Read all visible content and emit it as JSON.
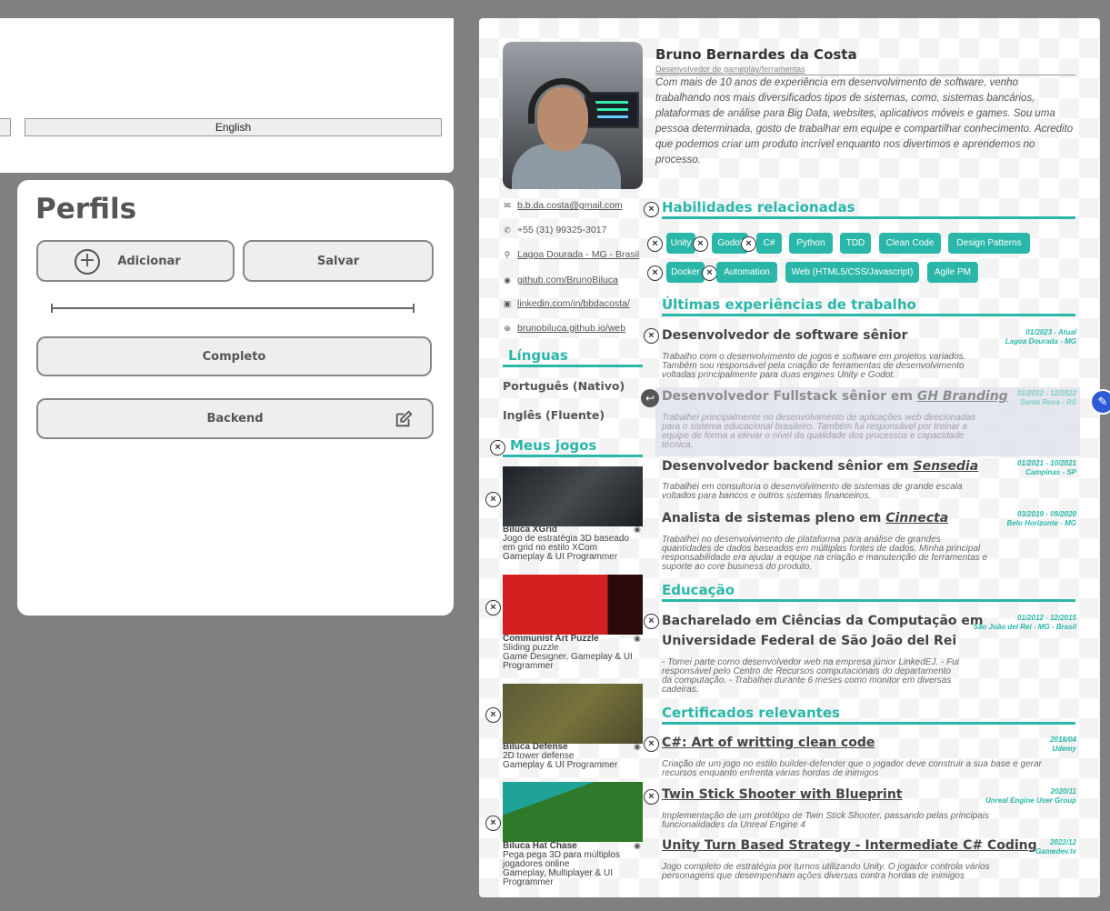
{
  "settings": {
    "language_button": "English"
  },
  "profiles": {
    "title": "Perfils",
    "add_label": "Adicionar",
    "save_label": "Salvar",
    "items": [
      "Completo",
      "Backend"
    ]
  },
  "resume": {
    "name": "Bruno Bernardes da Costa",
    "role": "Desenvolvedor de gameplay/ferramentas",
    "about": "Com mais de 10 anos de experiência em desenvolvimento de software, venho trabalhando nos mais diversificados tipos de sistemas, como, sistemas bancários, plataformas de análise para Big Data, websites, aplicativos móveis e games. Sou uma pessoa determinada, gosto de trabalhar em equipe e compartilhar conhecimento. Acredito que podemos criar um produto incrível enquanto nos divertimos e aprendemos no processo.",
    "contacts": [
      {
        "icon": "mail-icon",
        "glyph": "✉",
        "text": "b.b.da.costa@gmail.com"
      },
      {
        "icon": "phone-icon",
        "glyph": "✆",
        "text": "+55 (31) 99325-3017"
      },
      {
        "icon": "location-icon",
        "glyph": "⚲",
        "text": "Lagoa Dourada - MG - Brasil"
      },
      {
        "icon": "github-icon",
        "glyph": "◉",
        "text": "github.com/BrunoBiluca"
      },
      {
        "icon": "linkedin-icon",
        "glyph": "▣",
        "text": "linkedin.com/in/bbdacosta/"
      },
      {
        "icon": "globe-icon",
        "glyph": "⊕",
        "text": "brunobiluca.github.io/web"
      }
    ],
    "languages_title": "Línguas",
    "languages": [
      "Português (Nativo)",
      "Inglês (Fluente)"
    ],
    "games_title": "Meus jogos",
    "games": [
      {
        "title": "Biluca XGrid",
        "desc": "Jogo de estratégia 3D baseado em grid no estilo XCom",
        "roles": "Gameplay & UI Programmer"
      },
      {
        "title": "Communist Art Puzzle",
        "desc": "Sliding puzzle",
        "roles": "Game Designer, Gameplay & UI Programmer"
      },
      {
        "title": "Biluca Defense",
        "desc": "2D tower defense",
        "roles": "Gameplay & UI Programmer"
      },
      {
        "title": "Biluca Hat Chase",
        "desc": "Pega pega 3D para múltiplos jogadores online",
        "roles": "Gameplay, Multiplayer & UI Programmer"
      }
    ],
    "skills_title": "Habilidades relacionadas",
    "skills": [
      "Unity",
      "Godot",
      "C#",
      "Python",
      "TDD",
      "Clean Code",
      "Design Patterns",
      "Docker",
      "Automation",
      "Web (HTML5/CSS/Javascript)",
      "Agile PM"
    ],
    "experience_title": "Últimas experiências de trabalho",
    "experiences": [
      {
        "title": "Desenvolvedor de software sênior",
        "company": "",
        "date": "01/2023 - Atual",
        "place": "Lagoa Dourada - MG",
        "desc": "Trabalho com o desenvolvimento de jogos e software em projetos variados. Também sou responsável pela criação de ferramentas de desenvolvimento voltadas principalmente para duas engines Unity e Godot."
      },
      {
        "title": "Desenvolvedor Fullstack sênior em ",
        "company": "GH Branding",
        "date": "01/2022 - 12/2022",
        "place": "Santa Rosa - RS",
        "desc": "Trabalhei principalmente no desenvolvimento de aplicações web direcionadas para o sistema educacional brasileiro. Também fui responsável por treinar a equipe de forma a elevar o nível da qualidade dos processos e capacidade técnica."
      },
      {
        "title": "Desenvolvedor backend sênior em ",
        "company": "Sensedia",
        "date": "01/2021 - 10/2021",
        "place": "Campinas - SP",
        "desc": "Trabalhei em consultoria o desenvolvimento de sistemas de grande escala voltados para bancos e outros sistemas financeiros."
      },
      {
        "title": "Analista de sistemas pleno em ",
        "company": "Cinnecta",
        "date": "03/2019 - 09/2020",
        "place": "Belo Horizonte - MG",
        "desc": "Trabalhei no desenvolvimento de plataforma para análise de grandes quantidades de dados baseados em múltiplas fontes de dados. Minha principal responsabilidade era ajudar a equipe na criação e manutenção de ferramentas e suporte ao core business do produto."
      }
    ],
    "education_title": "Educação",
    "education": {
      "title1": "Bacharelado em Ciências da Computação em",
      "title2": "Universidade Federal de São João del Rei",
      "date": "01/2012 - 12/2015",
      "place": "São João del Rei - MG - Brasil",
      "desc": "- Tomei parte como desenvolvedor web na empresa júnior LinkedEJ. - Fui responsável pelo Centro de Recursos computacionais do departamento da computação. - Trabalhei durante 6 meses como monitor em diversas cadeiras."
    },
    "certs_title": "Certificados relevantes",
    "certs": [
      {
        "title": "C#: Art of writting clean code",
        "date": "2018/04",
        "issuer": "Udemy",
        "desc": "Criação de um jogo no estilo builder-defender que o jogador deve construir a sua base e gerar recursos enquanto enfrenta várias hordas de inimigos"
      },
      {
        "title": "Twin Stick Shooter with Blueprint",
        "date": "2020/11",
        "issuer": "Unreal Engine User Group",
        "desc": "Implementação de um protótipo de Twin Stick Shooter, passando pelas principais funcionalidades da Unreal Engine 4"
      },
      {
        "title": "Unity Turn Based Strategy - Intermediate C# Coding",
        "date": "2022/12",
        "issuer": "Gamedev.tv",
        "desc": "Jogo completo de estratégia por turnos utilizando Unity. O jogador controla vários personagens que desempenham ações diversas contra hordas de inimigos"
      }
    ]
  },
  "colors": {
    "accent": "#2ab7a9",
    "pen": "#2d5bd6"
  }
}
